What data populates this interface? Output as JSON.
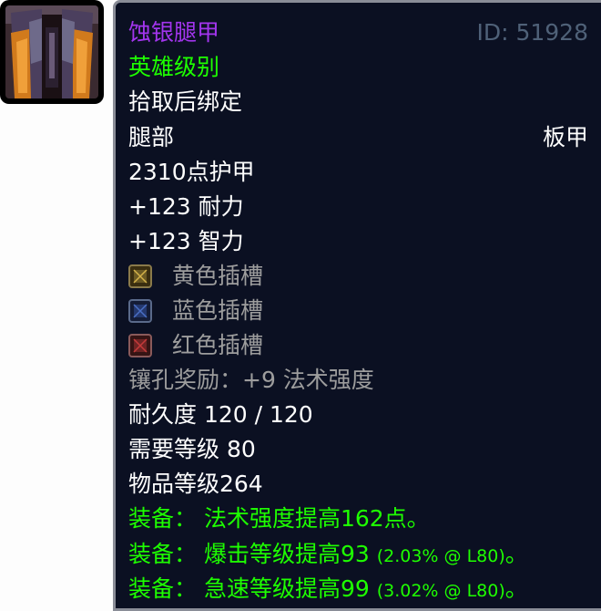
{
  "item": {
    "name": "蚀银腿甲",
    "id_label": "ID: 51928",
    "quality": "英雄级别",
    "bind": "拾取后绑定",
    "slot": "腿部",
    "armor_type": "板甲",
    "armor": "2310点护甲",
    "stats": [
      "+123 耐力",
      "+123 智力"
    ],
    "sockets": [
      {
        "label": "黄色插槽",
        "color": "#d4b24a"
      },
      {
        "label": "蓝色插槽",
        "color": "#4a6fc4"
      },
      {
        "label": "红色插槽",
        "color": "#c43a3a"
      }
    ],
    "socket_bonus": "镶孔奖励：+9 法术强度",
    "durability": "耐久度 120 / 120",
    "required_level": "需要等级 80",
    "item_level": "物品等级264",
    "equip_effects": [
      {
        "text": "装备： 法术强度提高162点。",
        "note": ""
      },
      {
        "text": "装备： 爆击等级提高93",
        "note": "(2.03% @ L80)",
        "end": "。"
      },
      {
        "text": "装备： 急速等级提高99",
        "note": "(3.02% @ L80)",
        "end": "。"
      }
    ]
  },
  "colors": {
    "name": "#a335ee",
    "quality": "#1eff00",
    "equip": "#1eff00",
    "gray": "#9d9d9d",
    "id": "#4f6178"
  },
  "icon": "plate-legs-item-icon"
}
